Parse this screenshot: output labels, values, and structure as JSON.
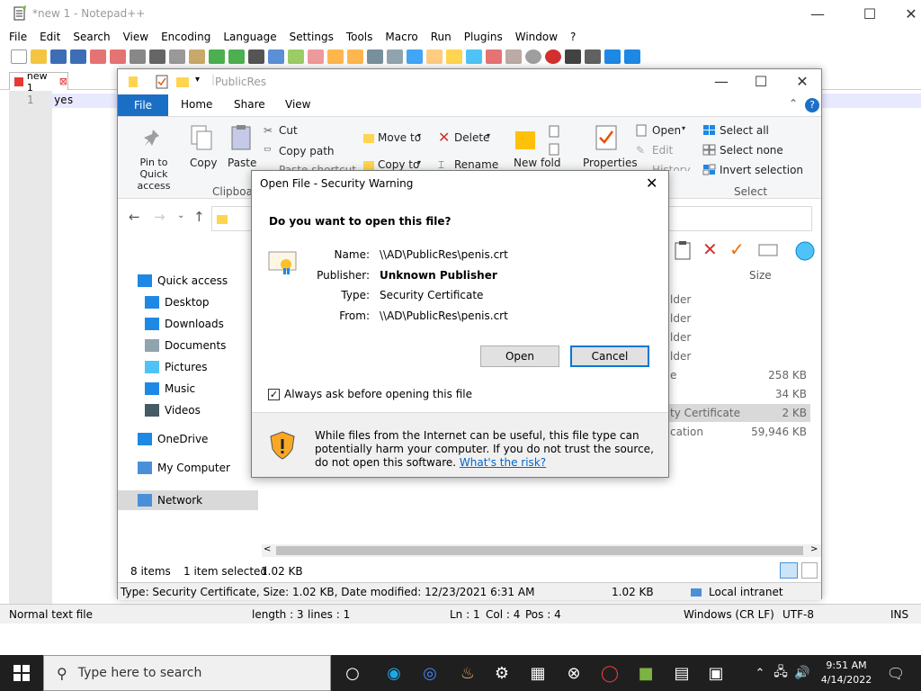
{
  "notepad": {
    "title": "*new 1 - Notepad++",
    "menu": [
      "File",
      "Edit",
      "Search",
      "View",
      "Encoding",
      "Language",
      "Settings",
      "Tools",
      "Macro",
      "Run",
      "Plugins",
      "Window",
      "?"
    ],
    "tab_label": "new 1",
    "line_number": "1",
    "content": "yes",
    "status": {
      "type": "Normal text file",
      "length": "length : 3",
      "lines": "lines : 1",
      "ln": "Ln : 1",
      "col": "Col : 4",
      "pos": "Pos : 4",
      "eol": "Windows (CR LF)",
      "encoding": "UTF-8",
      "mode": "INS"
    }
  },
  "explorer": {
    "title": "PublicRes",
    "tabs": [
      "File",
      "Home",
      "Share",
      "View"
    ],
    "ribbon": {
      "pin": "Pin to Quick access",
      "copy": "Copy",
      "paste": "Paste",
      "cut": "Cut",
      "copy_path": "Copy path",
      "paste_shortcut": "Paste shortcut",
      "clipboard_group": "Clipboar",
      "move_to": "Move to",
      "copy_to": "Copy to",
      "delete": "Delete",
      "rename": "Rename",
      "new_folder": "New fold",
      "properties": "Properties",
      "open": "Open",
      "edit": "Edit",
      "history": "History",
      "select_all": "Select all",
      "select_none": "Select none",
      "invert_selection": "Invert selection",
      "select_group": "Select"
    },
    "nav": [
      {
        "label": "Quick access",
        "icon": "star-icon"
      },
      {
        "label": "Desktop",
        "icon": "desktop-icon"
      },
      {
        "label": "Downloads",
        "icon": "download-icon"
      },
      {
        "label": "Documents",
        "icon": "documents-icon"
      },
      {
        "label": "Pictures",
        "icon": "pictures-icon"
      },
      {
        "label": "Music",
        "icon": "music-icon"
      },
      {
        "label": "Videos",
        "icon": "videos-icon"
      },
      {
        "label": "OneDrive",
        "icon": "cloud-icon"
      },
      {
        "label": "My Computer",
        "icon": "computer-icon"
      },
      {
        "label": "Network",
        "icon": "network-icon"
      }
    ],
    "size_header": "Size",
    "rows": [
      {
        "type": "lder",
        "size": ""
      },
      {
        "type": "lder",
        "size": ""
      },
      {
        "type": "lder",
        "size": ""
      },
      {
        "type": "lder",
        "size": ""
      },
      {
        "type": "e",
        "size": "258 KB"
      },
      {
        "type": "",
        "size": "34 KB"
      },
      {
        "type": "ty Certificate",
        "size": "2 KB"
      },
      {
        "type": "cation",
        "size": "59,946 KB"
      }
    ],
    "status_items": "8 items",
    "status_selected": "1 item selected",
    "status_size": "1.02 KB",
    "details": "Type: Security Certificate, Size: 1.02 KB, Date modified: 12/23/2021 6:31 AM",
    "details_size": "1.02 KB",
    "zone": "Local intranet"
  },
  "dialog": {
    "title": "Open File - Security Warning",
    "question": "Do you want to open this file?",
    "name_label": "Name:",
    "name_value": "\\\\AD\\PublicRes\\penis.crt",
    "publisher_label": "Publisher:",
    "publisher_value": "Unknown Publisher",
    "type_label": "Type:",
    "type_value": "Security Certificate",
    "from_label": "From:",
    "from_value": "\\\\AD\\PublicRes\\penis.crt",
    "open_button": "Open",
    "cancel_button": "Cancel",
    "checkbox_label": "Always ask before opening this file",
    "warning_text": "While files from the Internet can be useful, this file type can potentially harm your computer. If you do not trust the source, do not open this software.",
    "risk_link": "What's the risk?"
  },
  "taskbar": {
    "search_placeholder": "Type here to search",
    "time": "9:51 AM",
    "date": "4/14/2022"
  }
}
